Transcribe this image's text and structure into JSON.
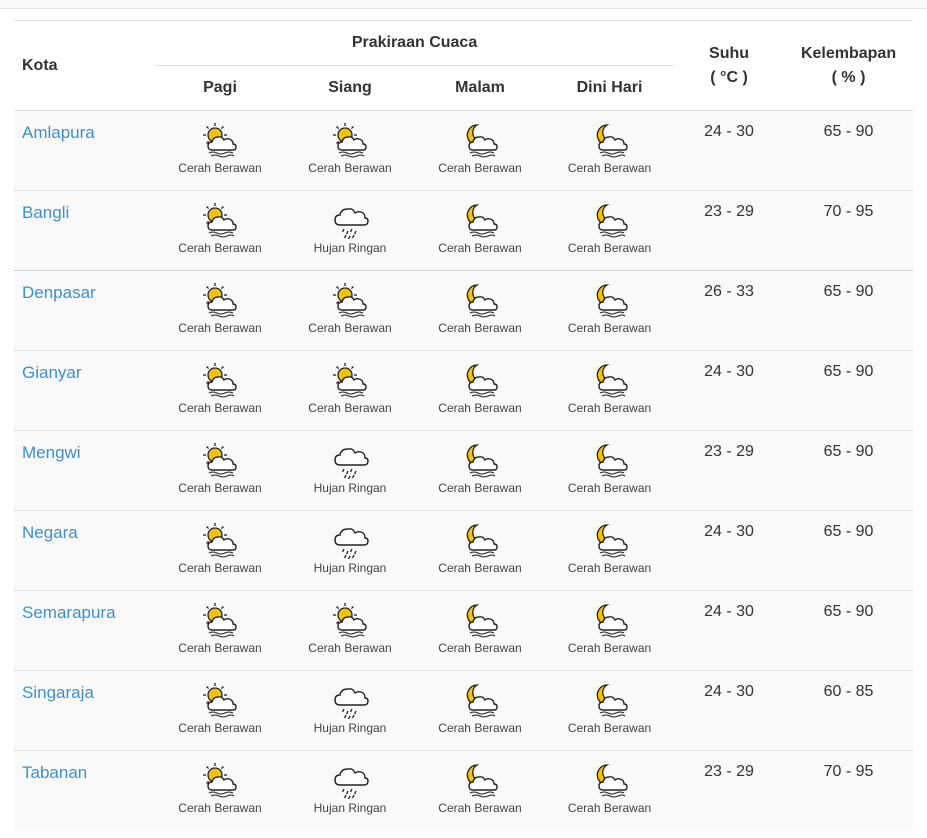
{
  "header": {
    "kota": "Kota",
    "forecast_group": "Prakiraan Cuaca",
    "periods": [
      "Pagi",
      "Siang",
      "Malam",
      "Dini Hari"
    ],
    "temp_label": "Suhu",
    "temp_unit": "( °C )",
    "humidity_label": "Kelembapan",
    "humidity_unit": "( % )"
  },
  "icon_map": {
    "Cerah Berawan day": "partly-cloudy-day-icon",
    "Cerah Berawan night": "partly-cloudy-night-icon",
    "Hujan Ringan": "light-rain-icon"
  },
  "colors": {
    "link": "#3d8fd1",
    "sun": "#f5c400",
    "moon": "#f5c400"
  },
  "rows": [
    {
      "city": "Amlapura",
      "forecast": [
        "Cerah Berawan",
        "Cerah Berawan",
        "Cerah Berawan",
        "Cerah Berawan"
      ],
      "temp": "24 - 30",
      "humidity": "65 - 90"
    },
    {
      "city": "Bangli",
      "forecast": [
        "Cerah Berawan",
        "Hujan Ringan",
        "Cerah Berawan",
        "Cerah Berawan"
      ],
      "temp": "23 - 29",
      "humidity": "70 - 95"
    },
    {
      "city": "Denpasar",
      "forecast": [
        "Cerah Berawan",
        "Cerah Berawan",
        "Cerah Berawan",
        "Cerah Berawan"
      ],
      "temp": "26 - 33",
      "humidity": "65 - 90"
    },
    {
      "city": "Gianyar",
      "forecast": [
        "Cerah Berawan",
        "Cerah Berawan",
        "Cerah Berawan",
        "Cerah Berawan"
      ],
      "temp": "24 - 30",
      "humidity": "65 - 90"
    },
    {
      "city": "Mengwi",
      "forecast": [
        "Cerah Berawan",
        "Hujan Ringan",
        "Cerah Berawan",
        "Cerah Berawan"
      ],
      "temp": "23 - 29",
      "humidity": "65 - 90"
    },
    {
      "city": "Negara",
      "forecast": [
        "Cerah Berawan",
        "Hujan Ringan",
        "Cerah Berawan",
        "Cerah Berawan"
      ],
      "temp": "24 - 30",
      "humidity": "65 - 90"
    },
    {
      "city": "Semarapura",
      "forecast": [
        "Cerah Berawan",
        "Cerah Berawan",
        "Cerah Berawan",
        "Cerah Berawan"
      ],
      "temp": "24 - 30",
      "humidity": "65 - 90"
    },
    {
      "city": "Singaraja",
      "forecast": [
        "Cerah Berawan",
        "Hujan Ringan",
        "Cerah Berawan",
        "Cerah Berawan"
      ],
      "temp": "24 - 30",
      "humidity": "60 - 85"
    },
    {
      "city": "Tabanan",
      "forecast": [
        "Cerah Berawan",
        "Hujan Ringan",
        "Cerah Berawan",
        "Cerah Berawan"
      ],
      "temp": "23 - 29",
      "humidity": "70 - 95"
    }
  ]
}
